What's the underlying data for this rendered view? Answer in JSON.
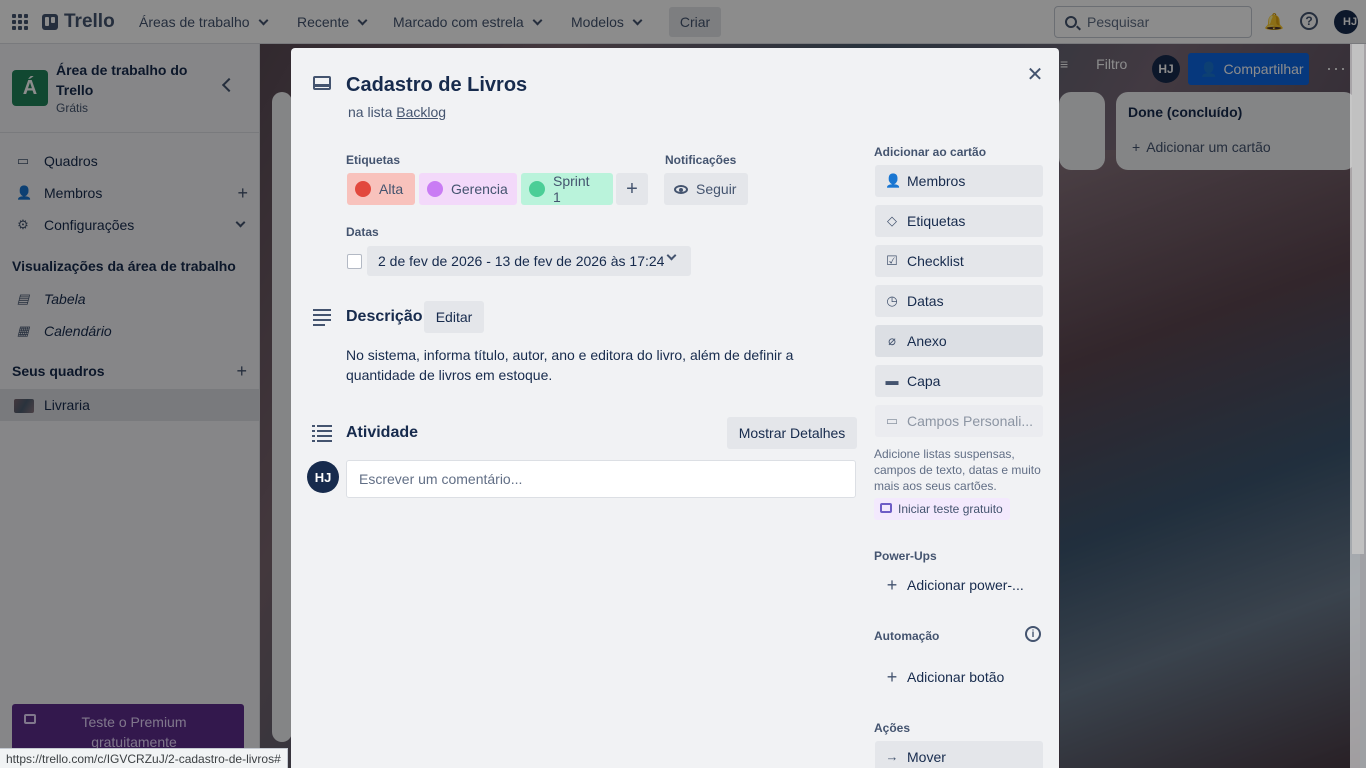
{
  "topnav": {
    "logo": "Trello",
    "menus": [
      "Áreas de trabalho",
      "Recente",
      "Marcado com estrela",
      "Modelos"
    ],
    "create_label": "Criar",
    "search_placeholder": "Pesquisar",
    "avatar_initials": "HJ"
  },
  "sidebar": {
    "workspace_initial": "Á",
    "workspace_name": "Área de trabalho do Trello",
    "workspace_plan": "Grátis",
    "items": [
      {
        "label": "Quadros"
      },
      {
        "label": "Membros"
      },
      {
        "label": "Configurações"
      }
    ],
    "views_title": "Visualizações da área de trabalho",
    "views": [
      {
        "label": "Tabela"
      },
      {
        "label": "Calendário"
      }
    ],
    "boards_title": "Seus quadros",
    "boards": [
      {
        "label": "Livraria"
      }
    ],
    "premium_label": "Teste o Premium gratuitamente"
  },
  "board": {
    "filter_label": "Filtro",
    "avatar_initials": "HJ",
    "share_label": "Compartilhar",
    "done_list_title": "Done (concluído)",
    "add_card_label": "Adicionar um cartão"
  },
  "card": {
    "title": "Cadastro de Livros",
    "in_list_prefix": "na lista",
    "list_name": "Backlog",
    "labels_title": "Etiquetas",
    "labels": [
      {
        "name": "Alta",
        "bg": "#f8c2bc",
        "dot": "#e2483d"
      },
      {
        "name": "Gerencia",
        "bg": "#f3d9fa",
        "dot": "#c97cf4"
      },
      {
        "name": "Sprint 1",
        "bg": "#baf3db",
        "dot": "#4bce97"
      }
    ],
    "notifications_title": "Notificações",
    "follow_label": "Seguir",
    "dates_title": "Datas",
    "dates_value": "2 de fev de 2026 - 13 de fev de 2026 às 17:24",
    "description_title": "Descrição",
    "edit_label": "Editar",
    "description_text": "No sistema, informa título, autor, ano e editora do livro, além de definir a quantidade de livros em estoque.",
    "activity_title": "Atividade",
    "show_details_label": "Mostrar Detalhes",
    "commenter_initials": "HJ",
    "comment_placeholder": "Escrever um comentário..."
  },
  "actions_panel": {
    "add_to_card_title": "Adicionar ao cartão",
    "add_buttons": [
      {
        "label": "Membros",
        "icon": "person-icon"
      },
      {
        "label": "Etiquetas",
        "icon": "tag-icon"
      },
      {
        "label": "Checklist",
        "icon": "checklist-icon"
      },
      {
        "label": "Datas",
        "icon": "clock-icon"
      },
      {
        "label": "Anexo",
        "icon": "paperclip-icon"
      },
      {
        "label": "Capa",
        "icon": "cover-icon"
      },
      {
        "label": "Campos Personali...",
        "icon": "custom-fields-icon"
      }
    ],
    "custom_fields_note": "Adicione listas suspensas, campos de texto, datas e muito mais aos seus cartões.",
    "trial_label": "Iniciar teste gratuito",
    "powerups_title": "Power-Ups",
    "add_powerup_label": "Adicionar power-...",
    "automation_title": "Automação",
    "add_button_label": "Adicionar botão",
    "actions_title": "Ações",
    "move_label": "Mover"
  },
  "status_bar": {
    "url": "https://trello.com/c/IGVCRZuJ/2-cadastro-de-livros#"
  }
}
